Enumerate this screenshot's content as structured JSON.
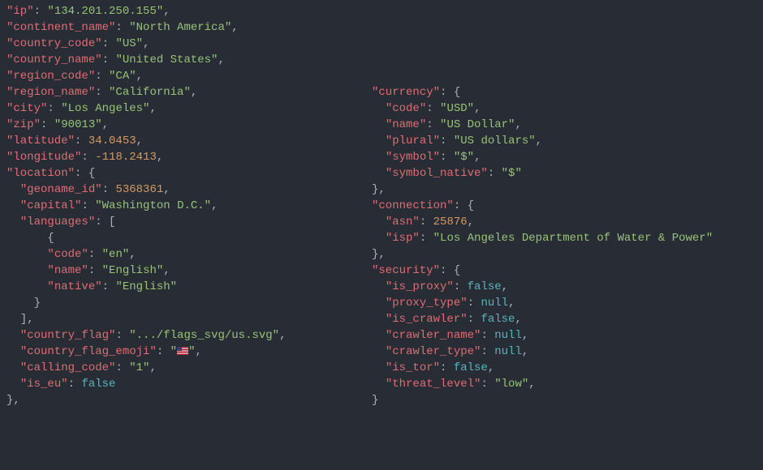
{
  "left": [
    {
      "t": "kv",
      "indent": 0,
      "key": "ip",
      "vtype": "s",
      "value": "134.201.250.155",
      "comma": true
    },
    {
      "t": "kv",
      "indent": 0,
      "key": "continent_name",
      "vtype": "s",
      "value": "North America",
      "comma": true
    },
    {
      "t": "kv",
      "indent": 0,
      "key": "country_code",
      "vtype": "s",
      "value": "US",
      "comma": true
    },
    {
      "t": "kv",
      "indent": 0,
      "key": "country_name",
      "vtype": "s",
      "value": "United States",
      "comma": true
    },
    {
      "t": "kv",
      "indent": 0,
      "key": "region_code",
      "vtype": "s",
      "value": "CA",
      "comma": true
    },
    {
      "t": "kv",
      "indent": 0,
      "key": "region_name",
      "vtype": "s",
      "value": "California",
      "comma": true
    },
    {
      "t": "kv",
      "indent": 0,
      "key": "city",
      "vtype": "s",
      "value": "Los Angeles",
      "comma": true
    },
    {
      "t": "kv",
      "indent": 0,
      "key": "zip",
      "vtype": "s",
      "value": "90013",
      "comma": true
    },
    {
      "t": "kv",
      "indent": 0,
      "key": "latitude",
      "vtype": "n",
      "value": "34.0453",
      "comma": true
    },
    {
      "t": "kv",
      "indent": 0,
      "key": "longitude",
      "vtype": "n",
      "value": "-118.2413",
      "comma": true
    },
    {
      "t": "open",
      "indent": 0,
      "key": "location",
      "brace": "{"
    },
    {
      "t": "kv",
      "indent": 1,
      "key": "geoname_id",
      "vtype": "n",
      "value": "5368361",
      "comma": true
    },
    {
      "t": "kv",
      "indent": 1,
      "key": "capital",
      "vtype": "s",
      "value": "Washington D.C.",
      "comma": true
    },
    {
      "t": "open",
      "indent": 1,
      "key": "languages",
      "brace": "["
    },
    {
      "t": "plain",
      "indent": 3,
      "text": "{"
    },
    {
      "t": "kv",
      "indent": 3,
      "key": "code",
      "vtype": "s",
      "value": "en",
      "comma": true
    },
    {
      "t": "kv",
      "indent": 3,
      "key": "name",
      "vtype": "s",
      "value": "English",
      "comma": true
    },
    {
      "t": "kv",
      "indent": 3,
      "key": "native",
      "vtype": "s",
      "value": "English",
      "comma": false
    },
    {
      "t": "plain",
      "indent": 2,
      "text": "}"
    },
    {
      "t": "plain",
      "indent": 1,
      "text": "],"
    },
    {
      "t": "kv",
      "indent": 1,
      "key": "country_flag",
      "vtype": "s",
      "value": ".../flags_svg/us.svg",
      "comma": true
    },
    {
      "t": "flag",
      "indent": 1,
      "key": "country_flag_emoji",
      "comma": true
    },
    {
      "t": "kv",
      "indent": 1,
      "key": "calling_code",
      "vtype": "s",
      "value": "1",
      "comma": true
    },
    {
      "t": "kv",
      "indent": 1,
      "key": "is_eu",
      "vtype": "b",
      "value": "false",
      "comma": false
    },
    {
      "t": "plain",
      "indent": 0,
      "text": "},"
    }
  ],
  "right_pad": 5,
  "right": [
    {
      "t": "open",
      "indent": 0,
      "key": "currency",
      "brace": "{"
    },
    {
      "t": "kv",
      "indent": 1,
      "key": "code",
      "vtype": "s",
      "value": "USD",
      "comma": true
    },
    {
      "t": "kv",
      "indent": 1,
      "key": "name",
      "vtype": "s",
      "value": "US Dollar",
      "comma": true
    },
    {
      "t": "kv",
      "indent": 1,
      "key": "plural",
      "vtype": "s",
      "value": "US dollars",
      "comma": true
    },
    {
      "t": "kv",
      "indent": 1,
      "key": "symbol",
      "vtype": "s",
      "value": "$",
      "comma": true
    },
    {
      "t": "kv",
      "indent": 1,
      "key": "symbol_native",
      "vtype": "s",
      "value": "$",
      "comma": false
    },
    {
      "t": "plain",
      "indent": 0,
      "text": "},"
    },
    {
      "t": "open",
      "indent": 0,
      "key": "connection",
      "brace": "{"
    },
    {
      "t": "kv",
      "indent": 1,
      "key": "asn",
      "vtype": "n",
      "value": "25876",
      "comma": true
    },
    {
      "t": "kv",
      "indent": 1,
      "key": "isp",
      "vtype": "s",
      "value": "Los Angeles Department of Water & Power",
      "comma": false
    },
    {
      "t": "plain",
      "indent": 0,
      "text": "},"
    },
    {
      "t": "open",
      "indent": 0,
      "key": "security",
      "brace": "{"
    },
    {
      "t": "kv",
      "indent": 1,
      "key": "is_proxy",
      "vtype": "b",
      "value": "false",
      "comma": true
    },
    {
      "t": "kv",
      "indent": 1,
      "key": "proxy_type",
      "vtype": "b",
      "value": "null",
      "comma": true
    },
    {
      "t": "kv",
      "indent": 1,
      "key": "is_crawler",
      "vtype": "b",
      "value": "false",
      "comma": true
    },
    {
      "t": "kv",
      "indent": 1,
      "key": "crawler_name",
      "vtype": "b",
      "value": "null",
      "comma": true
    },
    {
      "t": "kv",
      "indent": 1,
      "key": "crawler_type",
      "vtype": "b",
      "value": "null",
      "comma": true
    },
    {
      "t": "kv",
      "indent": 1,
      "key": "is_tor",
      "vtype": "b",
      "value": "false",
      "comma": true
    },
    {
      "t": "kv",
      "indent": 1,
      "key": "threat_level",
      "vtype": "s",
      "value": "low",
      "comma": true
    },
    {
      "t": "plain",
      "indent": 0,
      "text": "}"
    }
  ]
}
